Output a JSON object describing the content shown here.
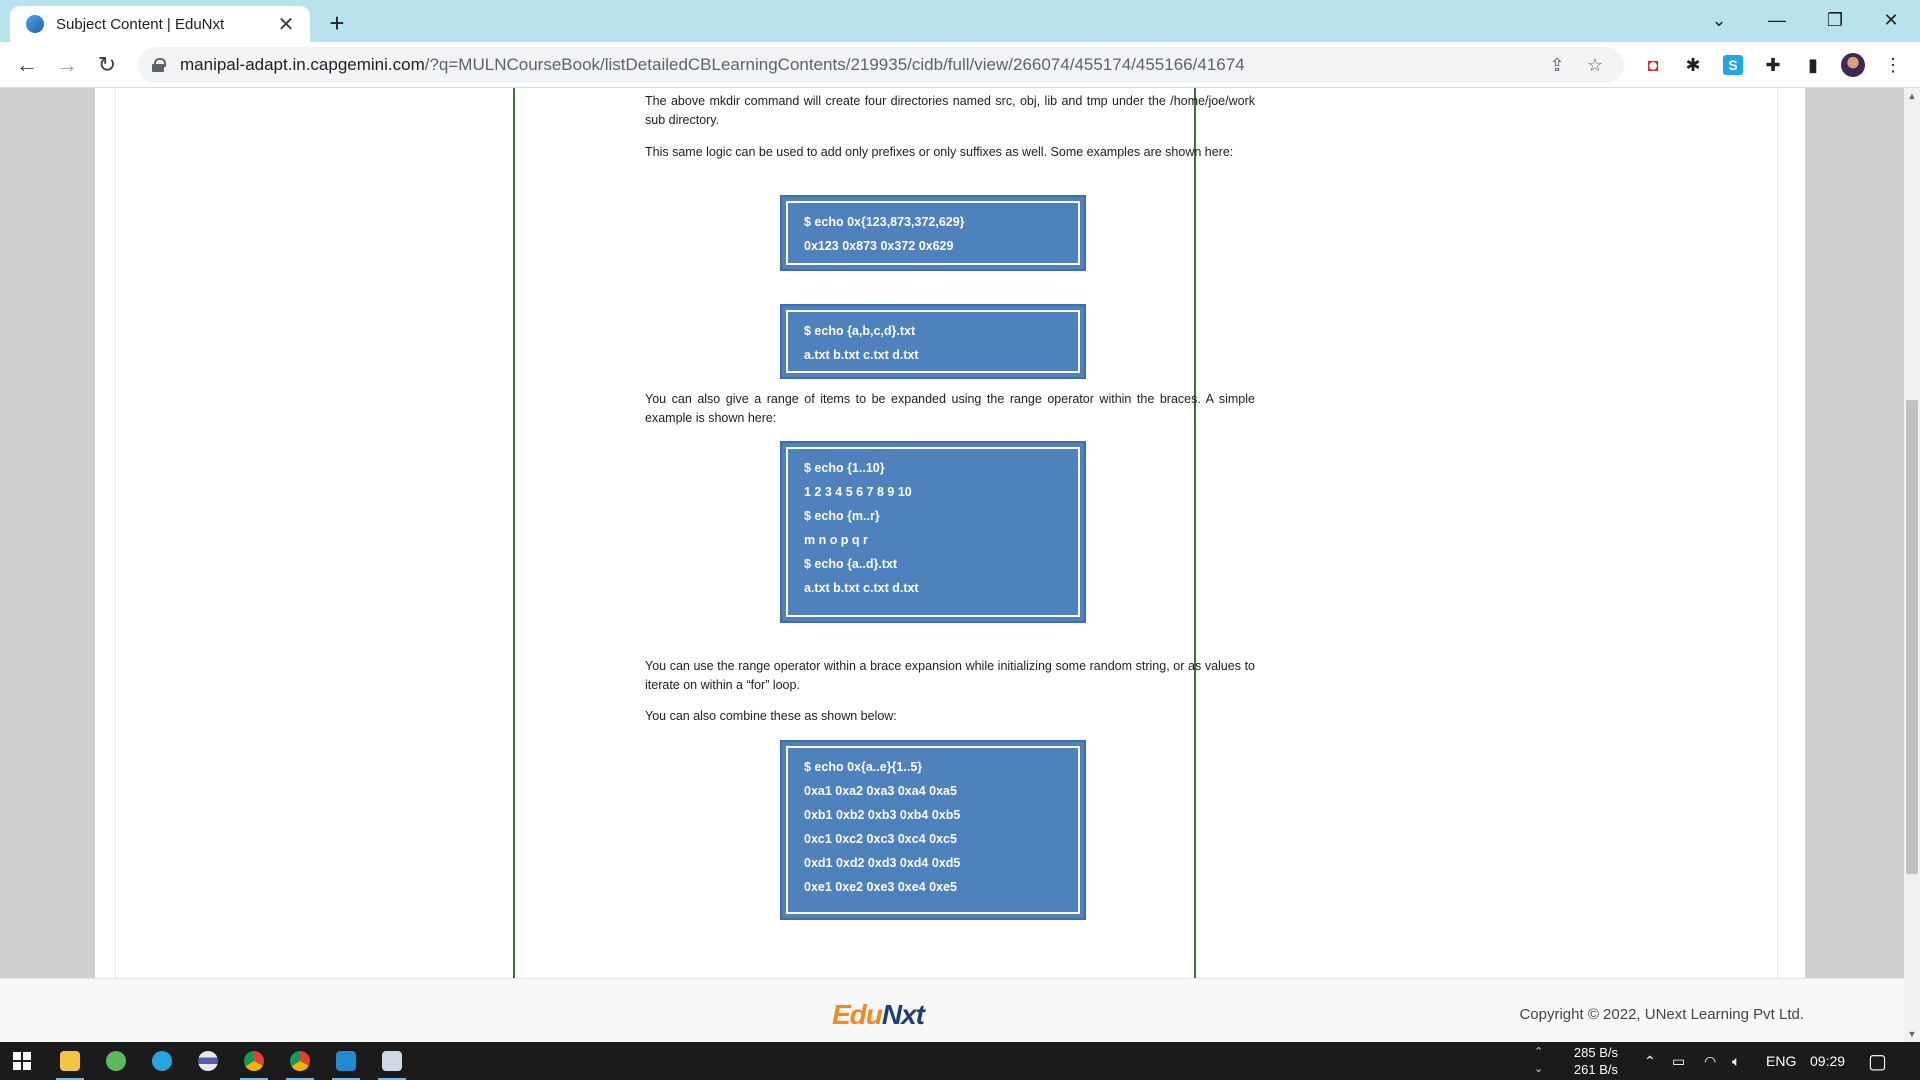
{
  "browser": {
    "tab_title": "Subject Content | EduNxt",
    "url_host": "manipal-adapt.in.capgemini.com",
    "url_path": "/?q=MULNCourseBook/listDetailedCBLearningContents/219935/cidb/full/view/266074/455174/455166/41674",
    "icons": {
      "tab_close": "close-icon",
      "new_tab": "plus-icon",
      "minimize": "minimize-icon",
      "restore": "restore-icon",
      "close": "close-icon",
      "back": "back-arrow-icon",
      "forward": "forward-arrow-icon",
      "reload": "reload-icon",
      "share": "share-icon",
      "bookmark": "star-icon",
      "extensions": "puzzle-icon",
      "side_panel": "side-panel-icon",
      "menu": "kebab-menu-icon"
    }
  },
  "content": {
    "para1": "The above mkdir command will create four directories named src, obj, lib and tmp under the /home/joe/work sub directory.",
    "para2": "This same logic can be used to add only prefixes or only suffixes as well. Some examples are shown here:",
    "code1": [
      "$ echo 0x{123,873,372,629}",
      "0x123 0x873 0x372 0x629"
    ],
    "code2": [
      "$ echo {a,b,c,d}.txt",
      "a.txt b.txt c.txt d.txt"
    ],
    "para3": "You can also give a range of items to be expanded using the range operator within the braces. A simple example is shown here:",
    "code3": [
      "$ echo {1..10}",
      "1 2 3 4 5 6 7 8 9 10",
      "$ echo {m..r}",
      "m n o p q r",
      "$ echo {a..d}.txt",
      "a.txt b.txt c.txt d.txt"
    ],
    "para4": "You can use the range operator within a brace expansion while initializing some random string, or as values to iterate on within a “for” loop.",
    "para5": "You can also combine these as shown below:",
    "code4": [
      "$ echo 0x{a..e}{1..5}",
      "0xa1 0xa2 0xa3 0xa4 0xa5",
      "0xb1 0xb2 0xb3 0xb4 0xb5",
      "0xc1 0xc2 0xc3 0xc4 0xc5",
      "0xd1 0xd2 0xd3 0xd4 0xd5",
      "0xe1 0xe2 0xe3 0xe4 0xe5"
    ]
  },
  "footer": {
    "logo_edu": "Edu",
    "logo_nxt": "Nxt",
    "copyright": "Copyright © 2022, UNext Learning Pvt Ltd."
  },
  "taskbar": {
    "net_up": "285 B/s",
    "net_down": "261 B/s",
    "lang": "ENG",
    "time": "09:29"
  },
  "colors": {
    "tab_strip": "#b8e3ee",
    "code_box": "#4f81bd",
    "doc_border": "#3c6e3c",
    "logo_orange": "#f08a24",
    "logo_blue": "#1d3f73"
  }
}
